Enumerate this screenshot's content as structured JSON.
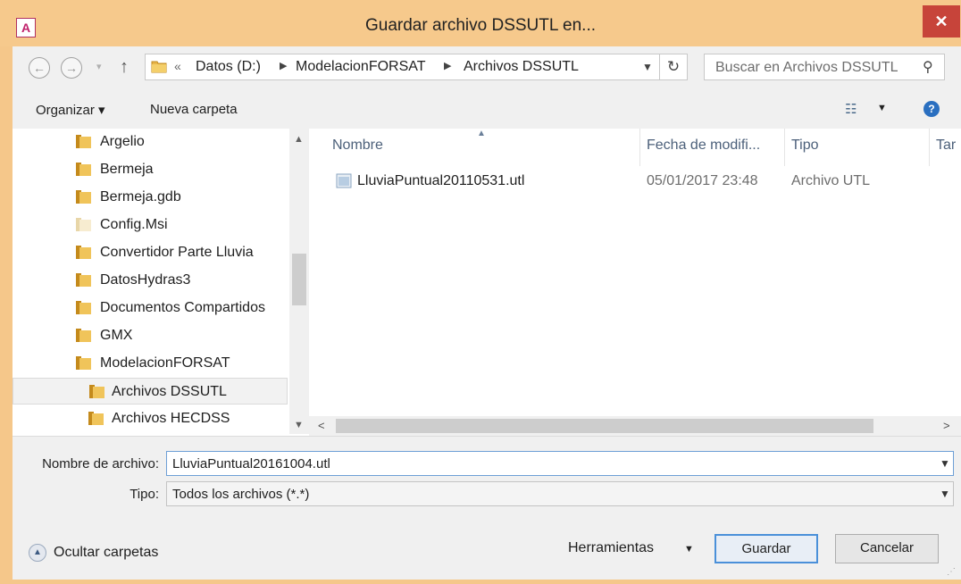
{
  "window": {
    "title": "Guardar archivo DSSUTL en...",
    "app_icon_letter": "A",
    "close_symbol": "✕"
  },
  "navigation": {
    "back_symbol": "←",
    "forward_symbol": "→",
    "up_symbol": "↑",
    "address": {
      "overflow_symbol": "«",
      "crumbs": [
        "Datos (D:)",
        "ModelacionFORSAT",
        "Archivos DSSUTL"
      ]
    },
    "refresh_symbol": "↻",
    "search_placeholder": "Buscar en Archivos DSSUTL"
  },
  "toolbar": {
    "organize_label": "Organizar ▾",
    "new_folder_label": "Nueva carpeta",
    "help_symbol": "?"
  },
  "tree": {
    "items": [
      {
        "label": "Argelio"
      },
      {
        "label": "Bermeja"
      },
      {
        "label": "Bermeja.gdb"
      },
      {
        "label": "Config.Msi"
      },
      {
        "label": "Convertidor Parte Lluvia"
      },
      {
        "label": "DatosHydras3"
      },
      {
        "label": "Documentos Compartidos"
      },
      {
        "label": "GMX"
      },
      {
        "label": "ModelacionFORSAT"
      },
      {
        "label": "Archivos DSSUTL",
        "selected": true
      },
      {
        "label": "Archivos HECDSS"
      }
    ]
  },
  "file_list": {
    "columns": [
      "Nombre",
      "Fecha de modifi...",
      "Tipo",
      "Tar"
    ],
    "files": [
      {
        "name": "LluviaPuntual20110531.utl",
        "date": "05/01/2017 23:48",
        "type": "Archivo UTL"
      }
    ]
  },
  "form": {
    "filename_label": "Nombre de archivo:",
    "filename_value": "LluviaPuntual20161004.utl",
    "type_label": "Tipo:",
    "type_value": "Todos los archivos (*.*)"
  },
  "footer": {
    "hide_folders_label": "Ocultar carpetas",
    "tools_label": "Herramientas",
    "save_label": "Guardar",
    "cancel_label": "Cancelar"
  },
  "colors": {
    "title_bar": "#f6c98c",
    "close_button": "#c7443a",
    "accent_border": "#4a90d9"
  }
}
